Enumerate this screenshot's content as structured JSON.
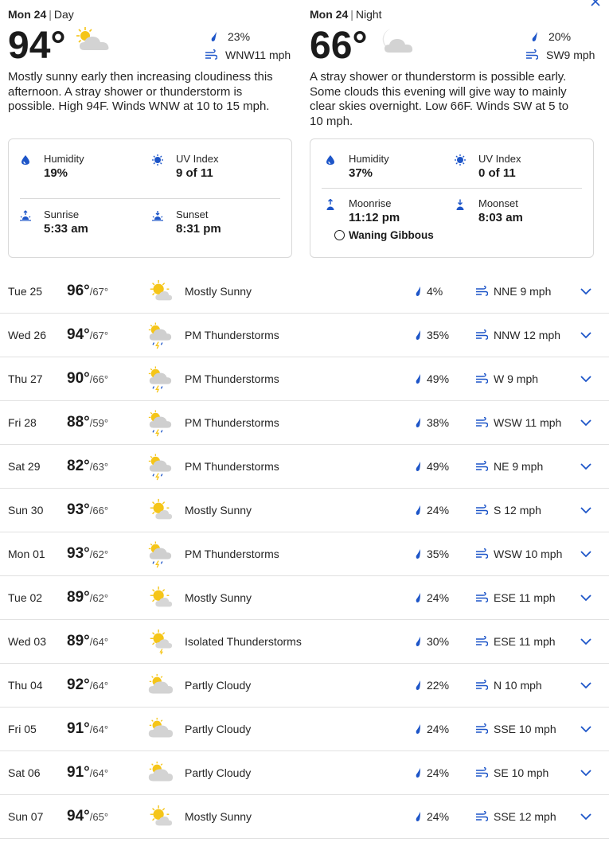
{
  "day": {
    "date_label": "Mon 24",
    "period": "Day",
    "temp": "94°",
    "icon": "sunny-cloudy-icon",
    "precip": "23%",
    "wind": "WNW11 mph",
    "narrative": "Mostly sunny early then increasing cloudiness this afternoon. A stray shower or thunderstorm is possible. High 94F. Winds WNW at 10 to 15 mph.",
    "humidity_label": "Humidity",
    "humidity": "19%",
    "uv_label": "UV Index",
    "uv": "9 of 11",
    "sunrise_label": "Sunrise",
    "sunrise": "5:33 am",
    "sunset_label": "Sunset",
    "sunset": "8:31 pm"
  },
  "night": {
    "date_label": "Mon 24",
    "period": "Night",
    "temp": "66°",
    "icon": "moon-cloud-icon",
    "precip": "20%",
    "wind": "SW9 mph",
    "narrative": "A stray shower or thunderstorm is possible early. Some clouds this evening will give way to mainly clear skies overnight. Low 66F. Winds SW at 5 to 10 mph.",
    "humidity_label": "Humidity",
    "humidity": "37%",
    "uv_label": "UV Index",
    "uv": "0 of 11",
    "moonrise_label": "Moonrise",
    "moonrise": "11:12 pm",
    "moonset_label": "Moonset",
    "moonset": "8:03 am",
    "moon_phase": "Waning Gibbous"
  },
  "colors": {
    "accent": "#1d55c8",
    "sun": "#f5c518",
    "cloud": "#c9c9c9",
    "divider": "#e1e1e1"
  },
  "daily": [
    {
      "date": "Tue 25",
      "hi": "96°",
      "lo": "67°",
      "icon": "mostly-sunny",
      "phrase": "Mostly Sunny",
      "precip": "4%",
      "wind": "NNE 9 mph"
    },
    {
      "date": "Wed 26",
      "hi": "94°",
      "lo": "67°",
      "icon": "thunderstorm",
      "phrase": "PM Thunderstorms",
      "precip": "35%",
      "wind": "NNW 12 mph"
    },
    {
      "date": "Thu 27",
      "hi": "90°",
      "lo": "66°",
      "icon": "thunderstorm",
      "phrase": "PM Thunderstorms",
      "precip": "49%",
      "wind": "W 9 mph"
    },
    {
      "date": "Fri 28",
      "hi": "88°",
      "lo": "59°",
      "icon": "thunderstorm",
      "phrase": "PM Thunderstorms",
      "precip": "38%",
      "wind": "WSW 11 mph"
    },
    {
      "date": "Sat 29",
      "hi": "82°",
      "lo": "63°",
      "icon": "thunderstorm",
      "phrase": "PM Thunderstorms",
      "precip": "49%",
      "wind": "NE 9 mph"
    },
    {
      "date": "Sun 30",
      "hi": "93°",
      "lo": "66°",
      "icon": "mostly-sunny",
      "phrase": "Mostly Sunny",
      "precip": "24%",
      "wind": "S 12 mph"
    },
    {
      "date": "Mon 01",
      "hi": "93°",
      "lo": "62°",
      "icon": "thunderstorm",
      "phrase": "PM Thunderstorms",
      "precip": "35%",
      "wind": "WSW 10 mph"
    },
    {
      "date": "Tue 02",
      "hi": "89°",
      "lo": "62°",
      "icon": "mostly-sunny",
      "phrase": "Mostly Sunny",
      "precip": "24%",
      "wind": "ESE 11 mph"
    },
    {
      "date": "Wed 03",
      "hi": "89°",
      "lo": "64°",
      "icon": "isolated-thunder",
      "phrase": "Isolated Thunderstorms",
      "precip": "30%",
      "wind": "ESE 11 mph"
    },
    {
      "date": "Thu 04",
      "hi": "92°",
      "lo": "64°",
      "icon": "partly-cloudy",
      "phrase": "Partly Cloudy",
      "precip": "22%",
      "wind": "N 10 mph"
    },
    {
      "date": "Fri 05",
      "hi": "91°",
      "lo": "64°",
      "icon": "partly-cloudy",
      "phrase": "Partly Cloudy",
      "precip": "24%",
      "wind": "SSE 10 mph"
    },
    {
      "date": "Sat 06",
      "hi": "91°",
      "lo": "64°",
      "icon": "partly-cloudy",
      "phrase": "Partly Cloudy",
      "precip": "24%",
      "wind": "SE 10 mph"
    },
    {
      "date": "Sun 07",
      "hi": "94°",
      "lo": "65°",
      "icon": "mostly-sunny",
      "phrase": "Mostly Sunny",
      "precip": "24%",
      "wind": "SSE 12 mph"
    }
  ]
}
